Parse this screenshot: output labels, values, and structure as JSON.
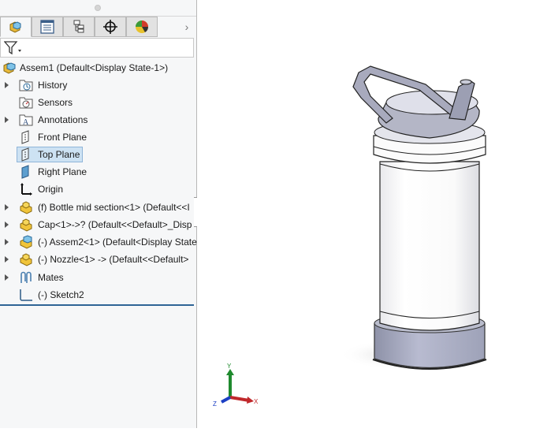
{
  "feature_manager": {
    "tabs": [
      {
        "name": "FeatureManager design tree",
        "icon": "assembly-tree-icon",
        "active": true
      },
      {
        "name": "PropertyManager",
        "icon": "property-manager-icon",
        "active": false
      },
      {
        "name": "ConfigurationManager",
        "icon": "configuration-manager-icon",
        "active": false
      },
      {
        "name": "DimXpertManager",
        "icon": "crosshair-icon",
        "active": false
      },
      {
        "name": "DisplayManager",
        "icon": "appearance-icon",
        "active": false
      }
    ],
    "more_tabs_glyph": "›",
    "filter": {
      "icon": "filter-icon",
      "dropdown_glyph": "▾"
    },
    "tree": [
      {
        "label": "Assem1  (Default<Display State-1>)",
        "icon": "assembly-icon",
        "expandable": false,
        "selected": false
      },
      {
        "label": "History",
        "icon": "history-folder-icon",
        "expandable": true,
        "selected": false
      },
      {
        "label": "Sensors",
        "icon": "sensors-folder-icon",
        "expandable": false,
        "selected": false
      },
      {
        "label": "Annotations",
        "icon": "annotations-folder-icon",
        "expandable": true,
        "selected": false
      },
      {
        "label": "Front Plane",
        "icon": "plane-icon",
        "expandable": false,
        "selected": false
      },
      {
        "label": "Top Plane",
        "icon": "plane-icon",
        "expandable": false,
        "selected": true
      },
      {
        "label": "Right Plane",
        "icon": "plane-filled-icon",
        "expandable": false,
        "selected": false
      },
      {
        "label": "Origin",
        "icon": "origin-icon",
        "expandable": false,
        "selected": false
      },
      {
        "label": "(f) Bottle mid section<1> (Default<<I",
        "icon": "part-icon",
        "expandable": true,
        "selected": false
      },
      {
        "label": "Cap<1>->? (Default<<Default>_Disp",
        "icon": "part-icon",
        "expandable": true,
        "selected": false
      },
      {
        "label": "(-) Assem2<1> (Default<Display State",
        "icon": "subassembly-icon",
        "expandable": true,
        "selected": false
      },
      {
        "label": "(-) Nozzle<1> -> (Default<<Default>",
        "icon": "part-icon",
        "expandable": true,
        "selected": false
      },
      {
        "label": "Mates",
        "icon": "mates-icon",
        "expandable": true,
        "selected": false
      },
      {
        "label": "(-) Sketch2",
        "icon": "sketch-icon",
        "expandable": false,
        "selected": false
      }
    ]
  },
  "viewport": {
    "model": "water bottle assembly with handled cap and nozzle",
    "triad": {
      "x_label": "X",
      "y_label": "Y",
      "z_label": "Z",
      "x_color": "#c0282b",
      "y_color": "#1f8a2e",
      "z_color": "#1c3fc4"
    }
  },
  "colors": {
    "panel_bg": "#f6f7f8",
    "selection_bg": "#cde2f3",
    "divider": "#2f6496",
    "cap_gray": "#b4b6c6",
    "body_white": "#fbfbfb"
  }
}
